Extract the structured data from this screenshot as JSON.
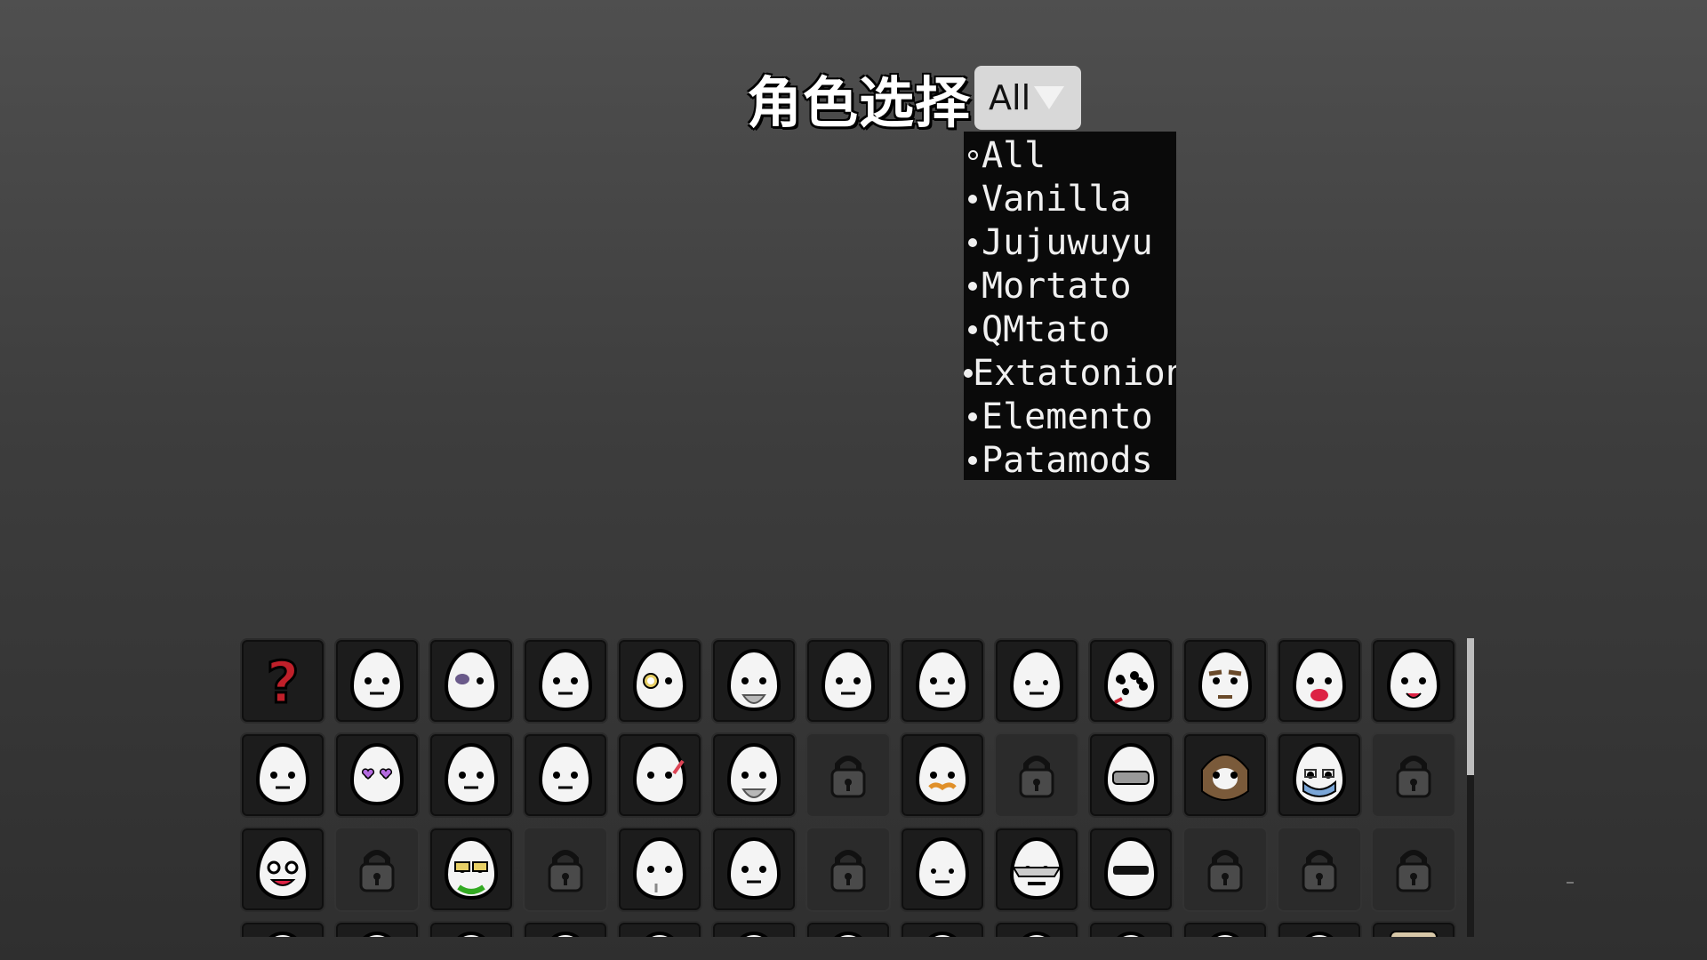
{
  "header": {
    "title": "角色选择",
    "filter_value": "All"
  },
  "filter_menu": {
    "selected_index": 0,
    "options": [
      "All",
      "Vanilla",
      "Jujuwuyu",
      "Mortato",
      "QMtato",
      "Extatonion",
      "Elemento",
      "Patamods"
    ]
  },
  "character_grid": {
    "columns": 13,
    "tiles": [
      "random",
      "egg",
      "egg-bruised",
      "egg",
      "egg-monocle",
      "egg-bearded-old",
      "egg",
      "egg-wrinkled",
      "egg-dot-eyes",
      "egg-many-eyes",
      "egg-bushy-brows",
      "egg-shout",
      "egg-happy",
      "egg-sad",
      "egg-heart-glasses",
      "egg",
      "egg",
      "egg-pencil",
      "egg-goatee",
      "locked",
      "egg-mustache",
      "locked",
      "egg-visor",
      "egg-hairy",
      "egg-mask",
      "locked",
      "egg-goggles-grin",
      "locked",
      "egg-shades",
      "locked",
      "egg-drool",
      "egg-worried",
      "locked",
      "egg-sleepy",
      "egg-spiked",
      "egg-visor-black",
      "locked",
      "locked",
      "locked",
      "egg",
      "egg",
      "egg",
      "egg",
      "egg",
      "egg",
      "egg",
      "egg",
      "egg",
      "egg",
      "egg",
      "egg",
      "egg-hand"
    ]
  },
  "colors": {
    "background_top": "#4f4f4f",
    "background_bottom": "#2f2f2f",
    "menu_background": "#0a0a0a",
    "dropdown_background": "#d8d8d8"
  },
  "icons": [
    "question-mark-icon",
    "egg-face-icon",
    "padlock-icon",
    "dropdown-caret-icon"
  ]
}
